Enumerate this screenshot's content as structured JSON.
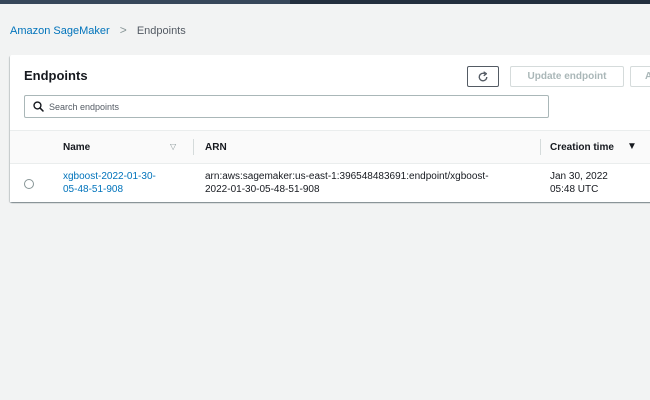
{
  "breadcrumb": {
    "root": "Amazon SageMaker",
    "separator": ">",
    "current": "Endpoints"
  },
  "panel": {
    "title": "Endpoints",
    "buttons": {
      "refresh_icon": "refresh-icon",
      "update_label": "Update endpoint",
      "more_label": "A"
    },
    "search": {
      "placeholder": "Search endpoints",
      "value": ""
    }
  },
  "table": {
    "columns": {
      "name": "Name",
      "arn": "ARN",
      "created": "Creation time"
    },
    "sort": {
      "column": "Creation time",
      "direction": "descending"
    },
    "rows": [
      {
        "name_line1": "xgboost-2022-01-30-",
        "name_line2": "05-48-51-908",
        "arn_line1": "arn:aws:sagemaker:us-east-1:396548483691:endpoint/xgboost-",
        "arn_line2": "2022-01-30-05-48-51-908",
        "created_line1": "Jan 30, 2022",
        "created_line2": "05:48 UTC",
        "selected": false
      }
    ]
  },
  "colors": {
    "link": "#0073bb",
    "background": "#f2f3f3",
    "topbar": "#232f3e"
  }
}
